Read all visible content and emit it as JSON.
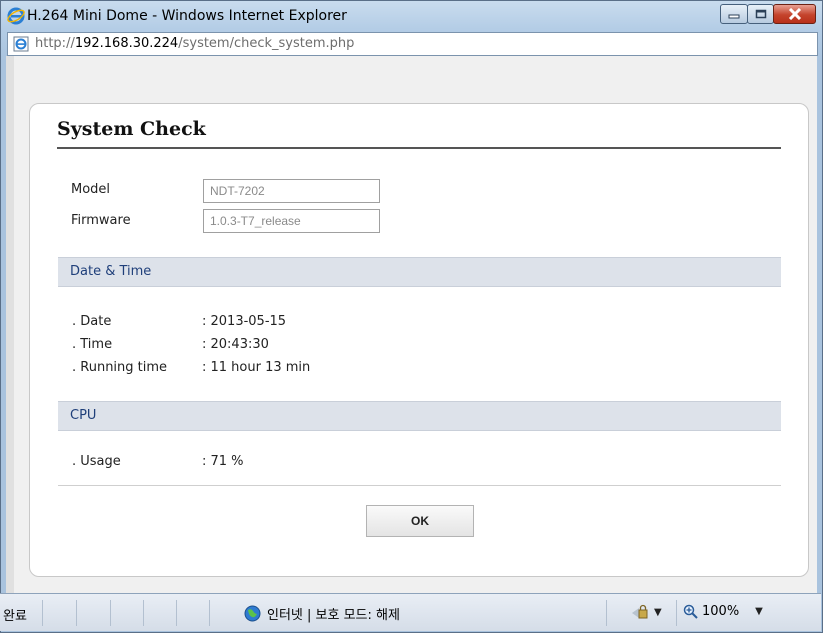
{
  "window": {
    "title": "H.264 Mini Dome - Windows Internet Explorer",
    "url_prefix": "http://",
    "url_host": "192.168.30.224",
    "url_path": "/system/check_system.php"
  },
  "dialog": {
    "title": "System Check",
    "model_label": "Model",
    "model_value": "NDT-7202",
    "firmware_label": "Firmware",
    "firmware_value": "1.0.3-T7_release",
    "datetime_section": "Date & Time",
    "date_label": ". Date",
    "date_value": ": 2013-05-15",
    "time_label": ". Time",
    "time_value": ": 20:43:30",
    "running_label": ". Running time",
    "running_value": ": 11 hour 13 min",
    "cpu_section": "CPU",
    "usage_label": ". Usage",
    "usage_value": ": 71 %",
    "ok_label": "OK"
  },
  "statusbar": {
    "left_text": "완료",
    "zone_text": "인터넷 | 보호 모드: 해제",
    "zoom_text": "100%"
  },
  "icons": [
    "ie-logo-icon",
    "page-icon",
    "globe-icon",
    "security-icon",
    "zoom-icon",
    "minimize-icon",
    "maximize-icon",
    "close-icon"
  ]
}
